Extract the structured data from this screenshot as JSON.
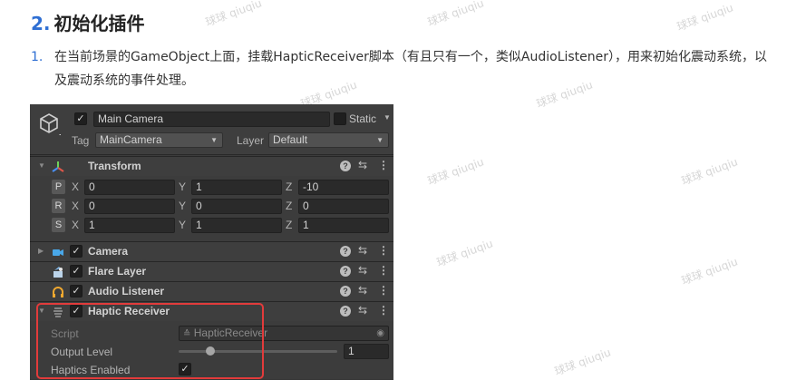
{
  "heading": {
    "number": "2.",
    "text": "初始化插件"
  },
  "paragraph": {
    "number": "1.",
    "text": "在当前场景的GameObject上面，挂载HapticReceiver脚本（有且只有一个，类似AudioListener），用来初始化震动系统，以及震动系统的事件处理。"
  },
  "watermark": "球球 qiuqiu",
  "inspector": {
    "object_name": "Main Camera",
    "static_label": "Static",
    "tag_label": "Tag",
    "tag_value": "MainCamera",
    "layer_label": "Layer",
    "layer_value": "Default",
    "transform": {
      "title": "Transform",
      "rows": [
        {
          "btn": "P",
          "x": "0",
          "y": "1",
          "z": "-10"
        },
        {
          "btn": "R",
          "x": "0",
          "y": "0",
          "z": "0"
        },
        {
          "btn": "S",
          "x": "1",
          "y": "1",
          "z": "1"
        }
      ],
      "axis_x": "X",
      "axis_y": "Y",
      "axis_z": "Z"
    },
    "components": [
      {
        "name": "Camera",
        "icon": "camera-icon"
      },
      {
        "name": "Flare Layer",
        "icon": "flare-layer-icon"
      },
      {
        "name": "Audio Listener",
        "icon": "headphones-icon"
      },
      {
        "name": "Haptic Receiver",
        "icon": "script-icon"
      }
    ],
    "haptic": {
      "script_label": "Script",
      "script_value": "HapticReceiver",
      "output_label": "Output Level",
      "output_value": "1",
      "output_slider_fraction": 0.2,
      "haptics_label": "Haptics Enabled",
      "haptics_checked": true
    },
    "icons": {
      "help": "help-icon",
      "settings": "preset-icon",
      "more": "more-icon"
    }
  },
  "colors": {
    "accent": "#2f6fd3",
    "highlight_box": "#e23b3b",
    "inspector_bg": "#3c3c3c"
  }
}
